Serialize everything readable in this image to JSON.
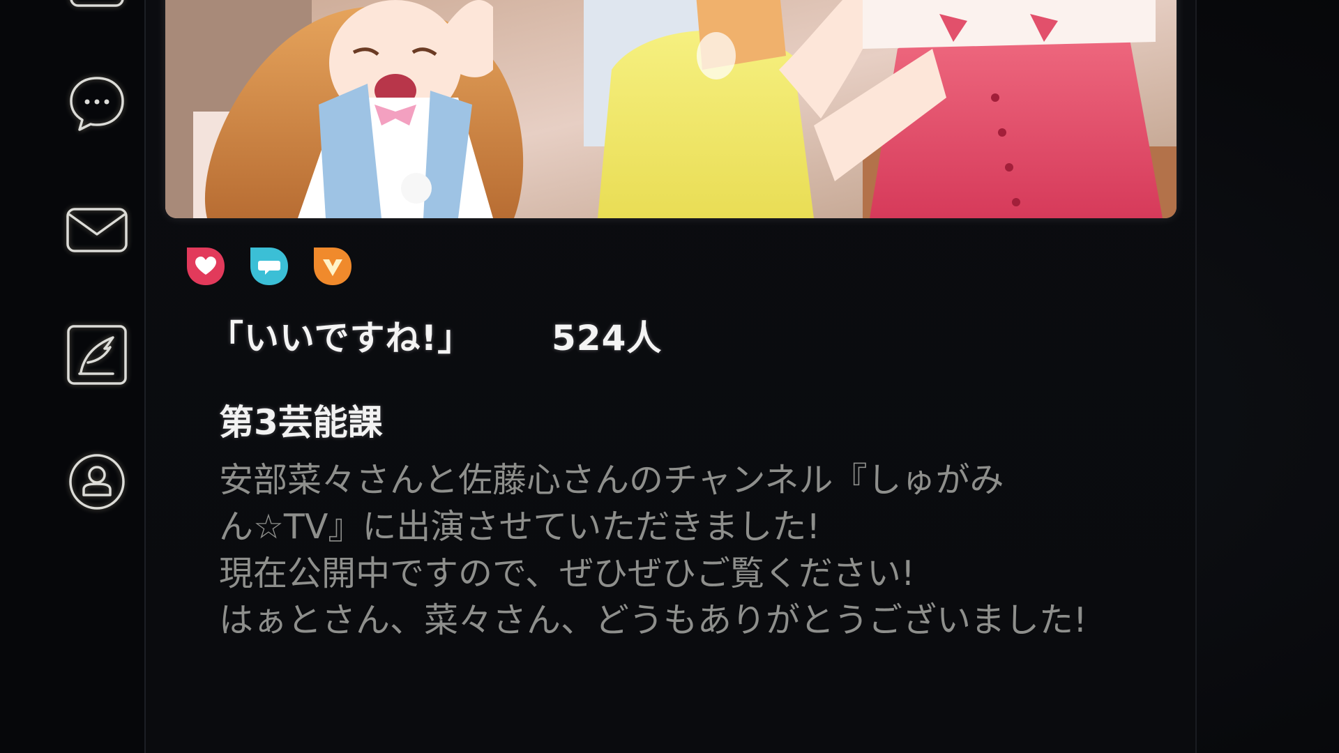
{
  "nav": {
    "items": [
      {
        "id": "messages",
        "icon": "chat-bubble-icon"
      },
      {
        "id": "mail",
        "icon": "envelope-icon"
      },
      {
        "id": "compose",
        "icon": "quill-icon"
      },
      {
        "id": "profile",
        "icon": "user-icon"
      }
    ]
  },
  "post": {
    "image": {
      "description_icon": "anime-screenshot-image"
    },
    "reactions": [
      {
        "id": "like",
        "icon": "heart-icon",
        "color": "#e23a5b"
      },
      {
        "id": "comment",
        "icon": "speech-bubble-icon",
        "color": "#3bbfd6"
      },
      {
        "id": "share",
        "icon": "v-arrow-icon",
        "color": "#f08a2c"
      }
    ],
    "likes_label": "「いいですね!」",
    "likes_count": "524人",
    "author": "第3芸能課",
    "body_lines": [
      "安部菜々さんと佐藤心さんのチャンネル『しゅがみ",
      "ん☆TV』に出演させていただきました!",
      "現在公開中ですので、ぜひぜひご覧ください!",
      "はぁとさん、菜々さん、どうもありがとうございました!"
    ]
  },
  "colors": {
    "background": "#07080b",
    "text_primary": "#f2f2f2",
    "text_body": "#8e8f8c",
    "icon_stroke": "#dcdcd8"
  }
}
